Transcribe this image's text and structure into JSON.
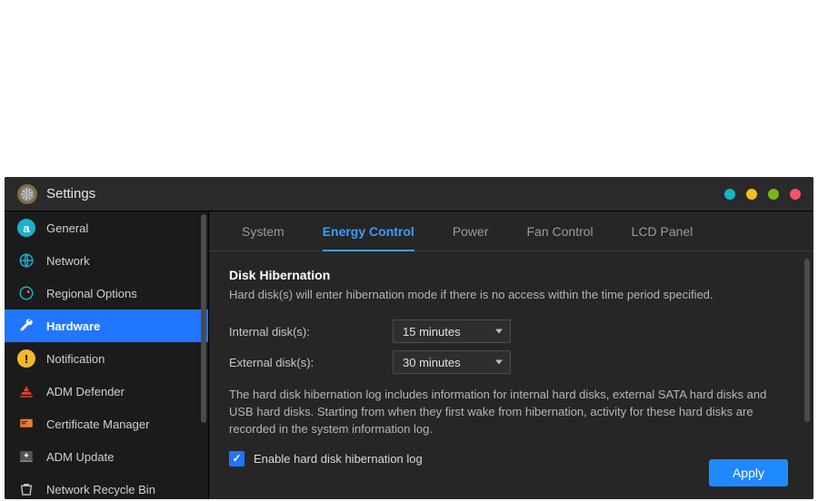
{
  "window": {
    "title": "Settings"
  },
  "sidebar": {
    "items": [
      {
        "label": "General"
      },
      {
        "label": "Network"
      },
      {
        "label": "Regional Options"
      },
      {
        "label": "Hardware"
      },
      {
        "label": "Notification"
      },
      {
        "label": "ADM Defender"
      },
      {
        "label": "Certificate Manager"
      },
      {
        "label": "ADM Update"
      },
      {
        "label": "Network Recycle Bin"
      }
    ]
  },
  "tabs": [
    {
      "label": "System"
    },
    {
      "label": "Energy Control"
    },
    {
      "label": "Power"
    },
    {
      "label": "Fan Control"
    },
    {
      "label": "LCD Panel"
    }
  ],
  "section": {
    "title": "Disk Hibernation",
    "description": "Hard disk(s) will enter hibernation mode if there is no access within the time period specified.",
    "internal_label": "Internal disk(s):",
    "internal_value": "15 minutes",
    "external_label": "External disk(s):",
    "external_value": "30 minutes",
    "log_paragraph": "The hard disk hibernation log includes information for internal hard disks, external SATA hard disks and USB hard disks. Starting from when they first wake from hibernation, activity for these hard disks are recorded in the system information log.",
    "checkbox_label": "Enable hard disk hibernation log"
  },
  "footer": {
    "apply": "Apply"
  }
}
